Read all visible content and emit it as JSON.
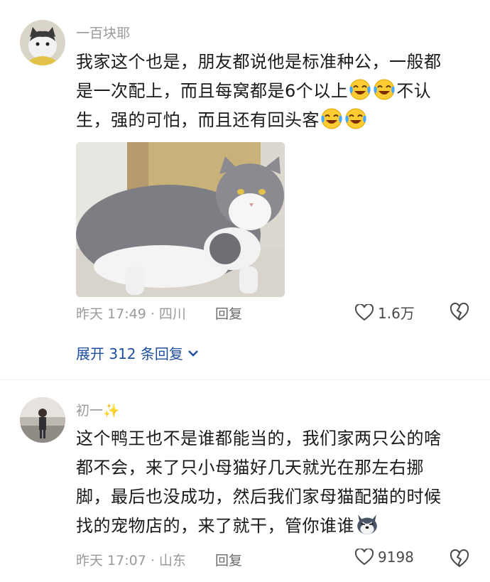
{
  "comments": [
    {
      "username": "一百块耶",
      "text_line1": "我家这个也是，朋友都说他是标准种公，一般都",
      "text_line2_before": "是一次配上，而且每窝都是6个以上",
      "text_line2_after": "不认",
      "text_line3": "生，强的可怕，而且还有回头客",
      "emoji_name": "laughing-crying-emoji",
      "timestamp": "昨天 17:49 · 四川",
      "reply_label": "回复",
      "likes": "1.6万",
      "expand_label": "展开 312 条回复"
    },
    {
      "username": "初一✨",
      "text_line1": "这个鸭王也不是谁都能当的，我们家两只公的啥",
      "text_line2": "都不会，来了只小母猫好几天就光在那左右挪",
      "text_line3": "脚，最后也没成功，然后我们家母猫配猫的时候",
      "text_line4": "找的宠物店的，来了就干，管你谁谁",
      "emoji_name": "husky-dog-emoji",
      "timestamp": "昨天 17:07 · 山东",
      "reply_label": "回复",
      "likes": "9198"
    }
  ],
  "colors": {
    "meta": "#9a9a9a",
    "link": "#1e4e9e",
    "text": "#1a1a1a"
  }
}
